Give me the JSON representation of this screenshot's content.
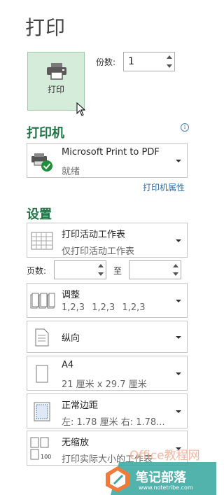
{
  "page": {
    "title": "打印"
  },
  "print_button": {
    "label": "打印",
    "icon": "printer-icon"
  },
  "copies": {
    "label": "份数:",
    "value": "1"
  },
  "printer": {
    "heading": "打印机",
    "name": "Microsoft Print to PDF",
    "status": "就绪",
    "properties_link": "打印机属性",
    "icon": "printer-ready-icon"
  },
  "settings": {
    "heading": "设置",
    "what_to_print": {
      "title": "打印活动工作表",
      "sub": "仅打印活动工作表"
    },
    "pages": {
      "label": "页数:",
      "to_label": "至",
      "from_value": "",
      "to_value": ""
    },
    "collate": {
      "title": "调整",
      "sub": "1,2,3    1,2,3    1,2,3"
    },
    "orientation": {
      "title": "纵向"
    },
    "paper": {
      "title": "A4",
      "sub": "21 厘米 x 29.7 厘米"
    },
    "margins": {
      "title": "正常边距",
      "sub": "左: 1.78 厘米    右: 1.78..."
    },
    "scaling": {
      "title": "无缩放",
      "sub": "打印实际大小的工作表"
    }
  },
  "watermark": {
    "brand": "Office教程网",
    "text": "笔记部落",
    "url": "www.notetribe.com"
  },
  "colors": {
    "accent": "#217346",
    "button_bg": "#d4ecd9",
    "link": "#2e6da4"
  }
}
